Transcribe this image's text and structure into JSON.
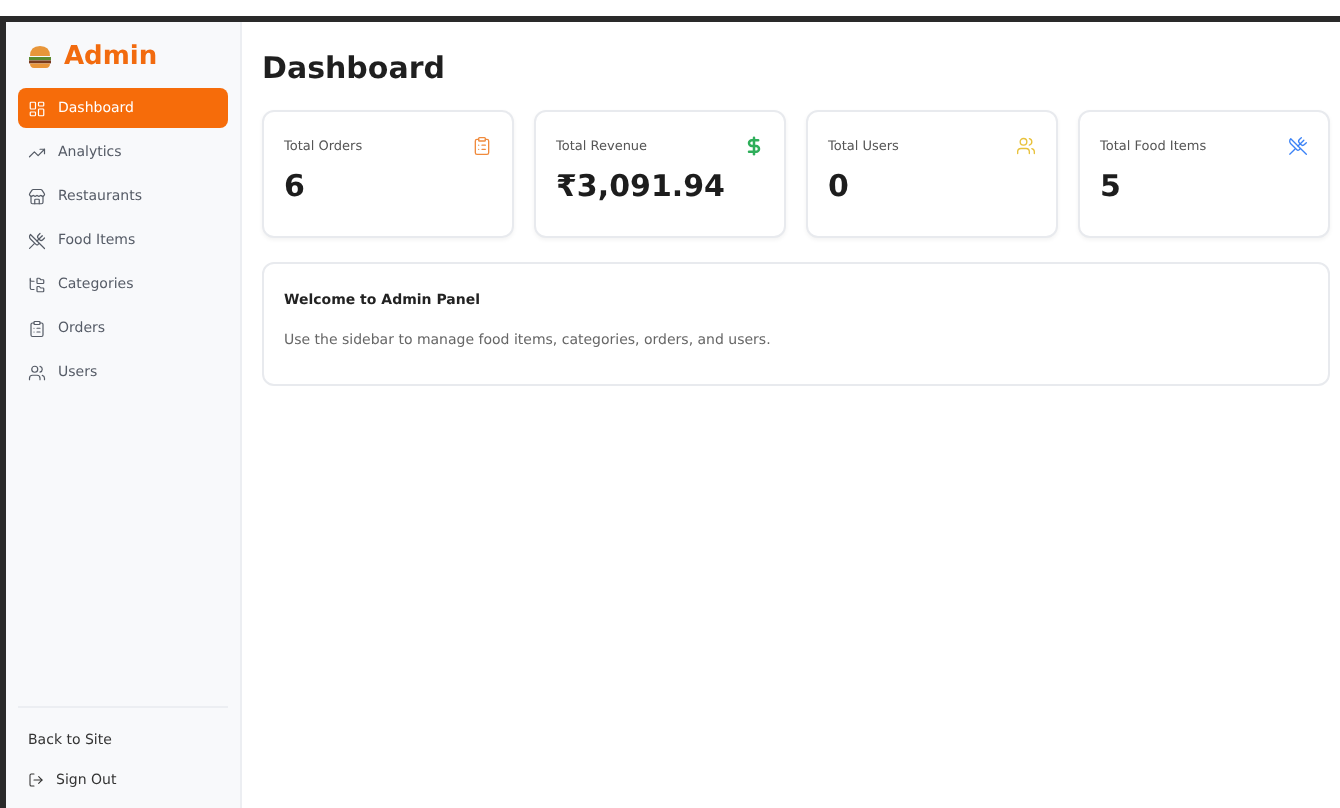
{
  "sidebar": {
    "brand": "Admin",
    "items": [
      {
        "label": "Dashboard",
        "kind": "dashboard",
        "selected": true
      },
      {
        "label": "Analytics",
        "kind": "trend",
        "selected": false
      },
      {
        "label": "Restaurants",
        "kind": "store",
        "selected": false
      },
      {
        "label": "Food Items",
        "kind": "utensils",
        "selected": false
      },
      {
        "label": "Categories",
        "kind": "tree",
        "selected": false
      },
      {
        "label": "Orders",
        "kind": "clipboard",
        "selected": false
      },
      {
        "label": "Users",
        "kind": "users",
        "selected": false
      }
    ],
    "footer": [
      {
        "label": "Back to Site",
        "kind": "plain"
      },
      {
        "label": "Sign Out",
        "kind": "logout"
      }
    ]
  },
  "page_title": "Dashboard",
  "stats": [
    {
      "label": "Total Orders",
      "value": "6",
      "kind": "clipboard",
      "color": "#f08a3c"
    },
    {
      "label": "Total Revenue",
      "value": "₹3,091.94",
      "kind": "dollar",
      "color": "#2eae5a"
    },
    {
      "label": "Total Users",
      "value": "0",
      "kind": "users",
      "color": "#e8c13a"
    },
    {
      "label": "Total Food Items",
      "value": "5",
      "kind": "utensils",
      "color": "#3b82f6"
    }
  ],
  "welcome": {
    "title": "Welcome to Admin Panel",
    "text": "Use the sidebar to manage food items, categories, orders, and users."
  }
}
